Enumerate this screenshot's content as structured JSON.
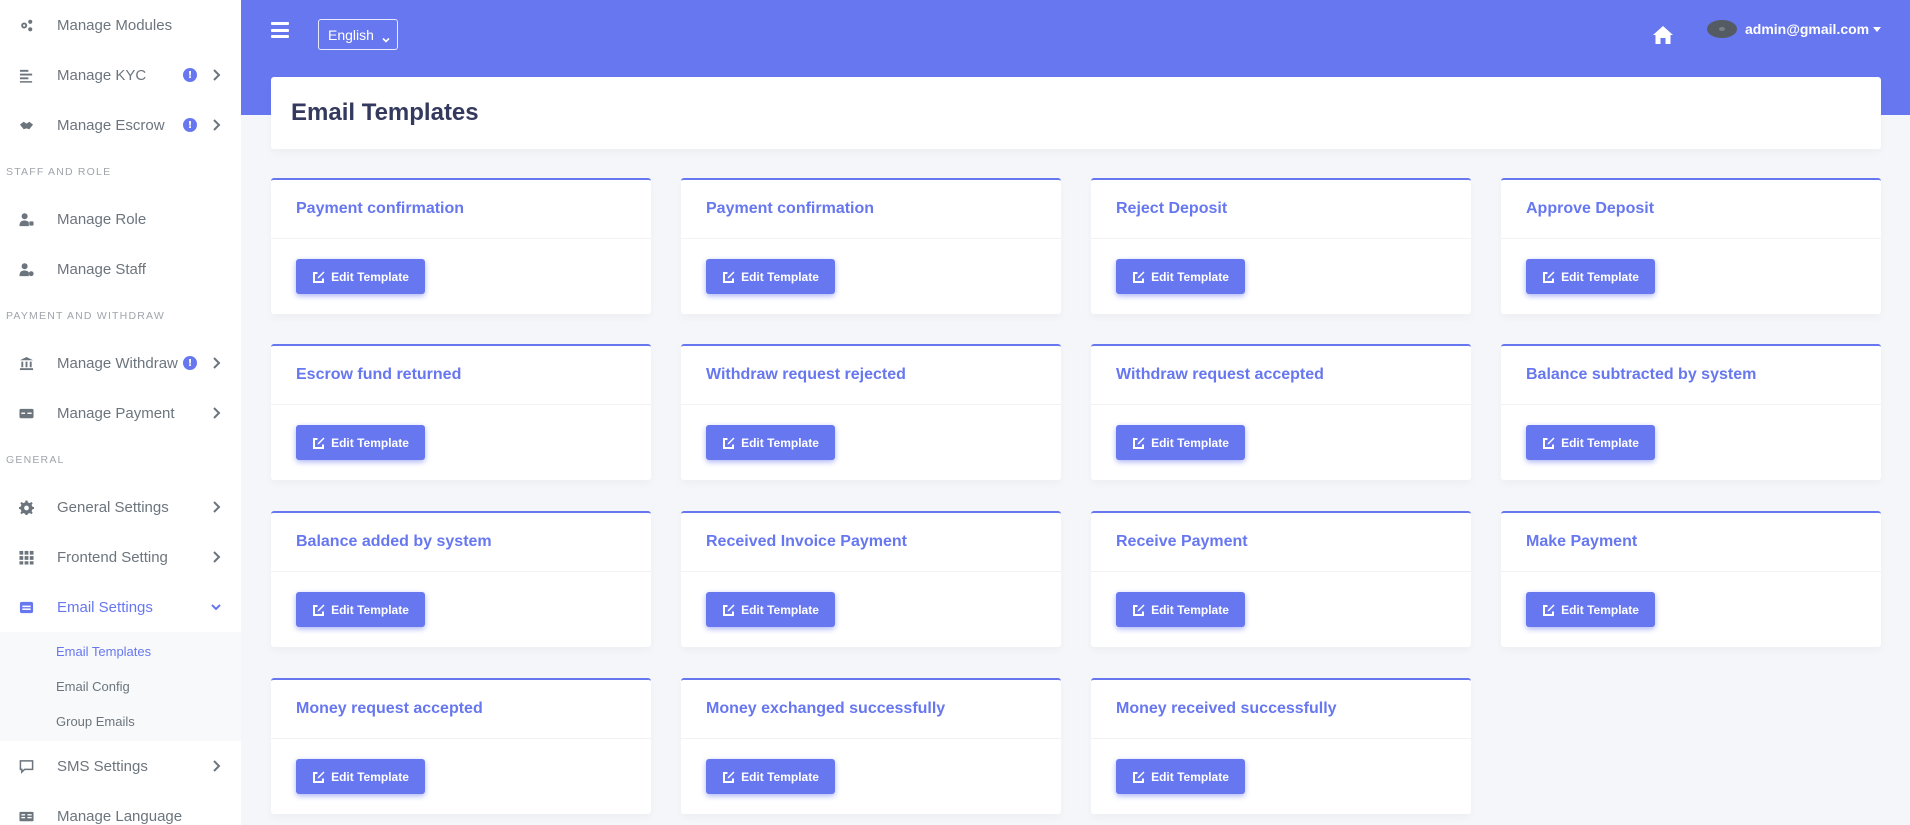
{
  "sidebar": {
    "items_top": [
      {
        "label": "Manage Modules",
        "icon": "cogs-icon",
        "badge": "",
        "chevron": false
      },
      {
        "label": "Manage KYC",
        "icon": "list-icon",
        "badge": "!",
        "chevron": true
      },
      {
        "label": "Manage Escrow",
        "icon": "handshake-icon",
        "badge": "!",
        "chevron": true
      }
    ],
    "section_staff": "STAFF AND ROLE",
    "items_staff": [
      {
        "label": "Manage Role",
        "icon": "user-tag-icon"
      },
      {
        "label": "Manage Staff",
        "icon": "user-cog-icon"
      }
    ],
    "section_payment": "PAYMENT AND WITHDRAW",
    "items_payment": [
      {
        "label": "Manage Withdraw",
        "icon": "bank-icon",
        "badge": "!"
      },
      {
        "label": "Manage Payment",
        "icon": "money-card-icon"
      }
    ],
    "section_general": "GENERAL",
    "items_general": [
      {
        "label": "General Settings",
        "icon": "gear-icon"
      },
      {
        "label": "Frontend Setting",
        "icon": "grid-icon"
      },
      {
        "label": "Email Settings",
        "icon": "envelope-icon"
      }
    ],
    "email_submenu": [
      "Email Templates",
      "Email Config",
      "Group Emails"
    ],
    "items_bottom": [
      {
        "label": "SMS Settings",
        "icon": "comment-icon"
      },
      {
        "label": "Manage Language",
        "icon": "language-icon"
      }
    ]
  },
  "topbar": {
    "language": "English",
    "user_email": "admin@gmail.com"
  },
  "page": {
    "title": "Email Templates",
    "button_label": "Edit Template"
  },
  "templates": [
    "Payment confirmation",
    "Payment confirmation",
    "Reject Deposit",
    "Approve Deposit",
    "Escrow fund returned",
    "Withdraw request rejected",
    "Withdraw request accepted",
    "Balance subtracted by system",
    "Balance added by system",
    "Received Invoice Payment",
    "Receive Payment",
    "Make Payment",
    "Money request accepted",
    "Money exchanged successfully",
    "Money received successfully"
  ],
  "colors": {
    "accent": "#6777ef",
    "background": "#f4f6f9"
  }
}
